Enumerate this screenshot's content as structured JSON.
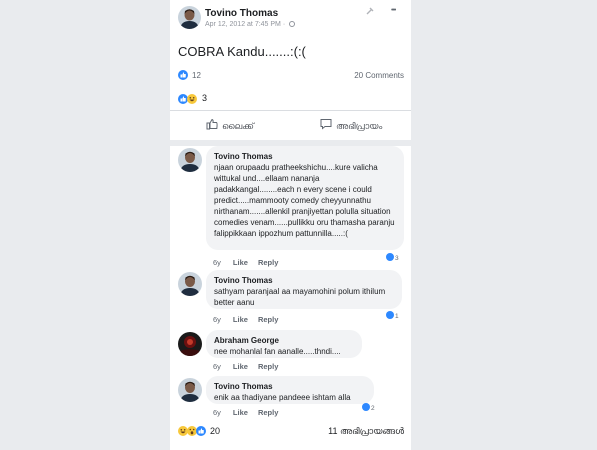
{
  "post": {
    "author": "Tovino Thomas",
    "date": "Apr 12, 2012 at 7:45 PM",
    "meta_sep": "·",
    "text": "COBRA Kandu.......:(:(",
    "reaction_count": "12",
    "comment_count": "20 Comments",
    "reaction_count_secondary": "3",
    "more_icon": "•••"
  },
  "actions": {
    "like_label": "ലൈക്ക്",
    "comment_label": "അഭിപ്രായം"
  },
  "comments": [
    {
      "author": "Tovino Thomas",
      "text": "njaan orupaadu pratheekshichu....kure valicha wittukal und....ellaam nananja padakkangal........each n every scene i could predict.....mammooty comedy cheyyunnathu nirthanam.......allenkil pranjiyettan polulla situation comedies venam......pullikku oru thamasha paranju falippikkaan ippozhum pattunnilla.....:(",
      "time": "6y",
      "like": "Like",
      "reply": "Reply",
      "likes": "3"
    },
    {
      "author": "Tovino Thomas",
      "text": "sathyam paranjaal aa mayamohini polum ithilum better aanu",
      "time": "6y",
      "like": "Like",
      "reply": "Reply",
      "likes": "1"
    },
    {
      "author": "Abraham George",
      "text": "nee mohanlal fan aanalle.....thndi....",
      "time": "6y",
      "like": "Like",
      "reply": "Reply",
      "likes": ""
    },
    {
      "author": "Tovino Thomas",
      "text": "enik aa thadiyane pandeee ishtam alla",
      "time": "6y",
      "like": "Like",
      "reply": "Reply",
      "likes": "2"
    }
  ],
  "footer": {
    "reaction_count": "20",
    "comment_count": "11 അഭിപ്രായങ്ങൾ"
  },
  "colors": {
    "like_blue": "#2d88ff",
    "haha_yellow": "#f7c83b",
    "bubble_bg": "#f2f3f5",
    "page_bg": "#e9ebee"
  },
  "icons": {
    "like_button": "thumbs-up-icon",
    "comment_button": "speech-bubble-icon",
    "more": "ellipsis-icon",
    "privacy": "globe-icon"
  }
}
